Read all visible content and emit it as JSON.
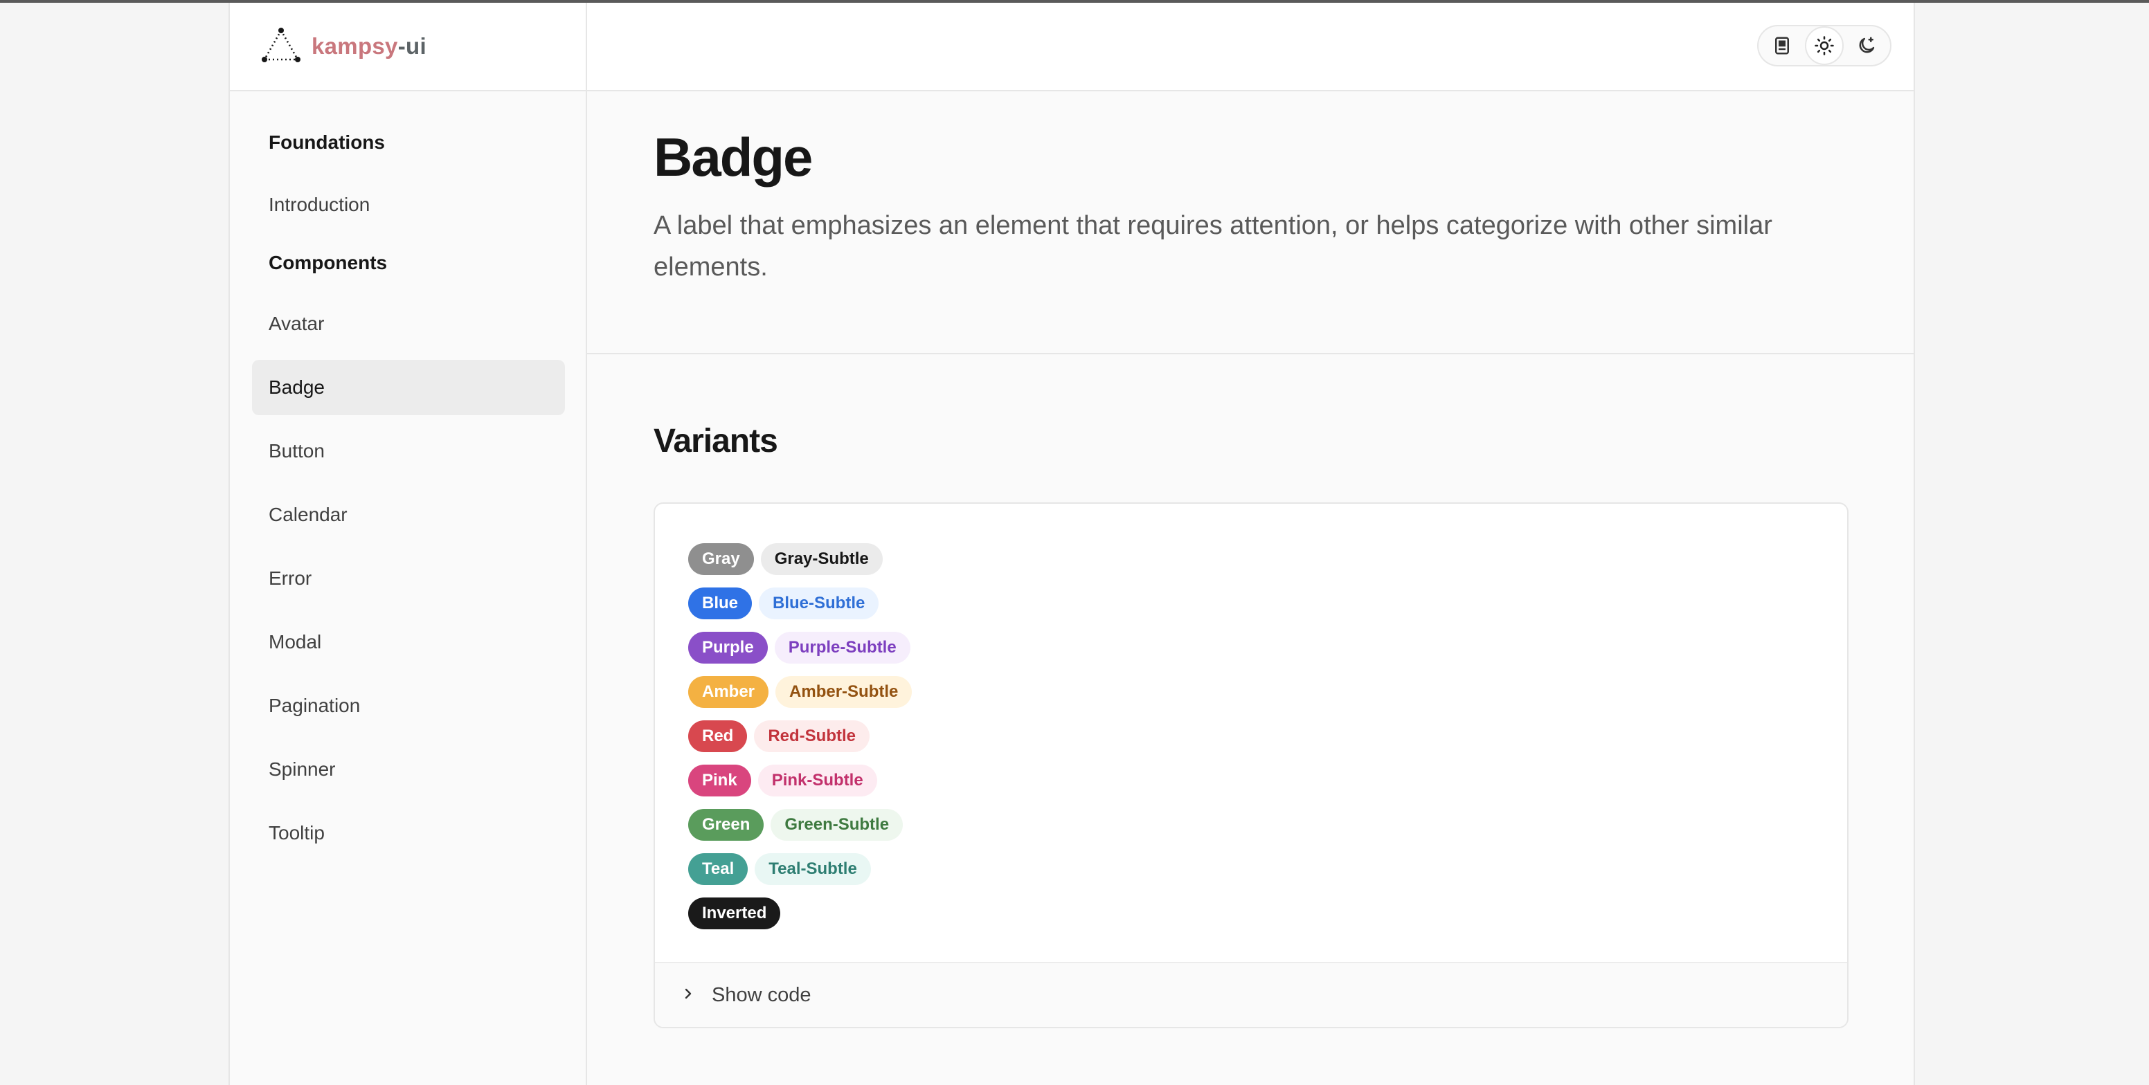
{
  "brand": {
    "name_part1": "kampsy",
    "name_part2": "-ui"
  },
  "sidebar": {
    "foundations_heading": "Foundations",
    "introduction": "Introduction",
    "components_heading": "Components",
    "items": [
      {
        "label": "Avatar"
      },
      {
        "label": "Badge",
        "active": true
      },
      {
        "label": "Button"
      },
      {
        "label": "Calendar"
      },
      {
        "label": "Error"
      },
      {
        "label": "Modal"
      },
      {
        "label": "Pagination"
      },
      {
        "label": "Spinner"
      },
      {
        "label": "Tooltip"
      }
    ]
  },
  "topbar": {
    "theme_buttons": [
      "book-icon",
      "sun-icon",
      "moon-icon"
    ],
    "active_theme": "sun-icon"
  },
  "page": {
    "title": "Badge",
    "description": "A label that emphasizes an element that requires attention, or helps categorize with other similar elements."
  },
  "variants": {
    "title": "Variants",
    "rows": [
      {
        "solid": {
          "label": "Gray",
          "bg": "#8f8f8f",
          "fg": "#ffffff"
        },
        "subtle": {
          "label": "Gray-Subtle",
          "bg": "#ebebeb",
          "fg": "#171717"
        }
      },
      {
        "solid": {
          "label": "Blue",
          "bg": "#2f72e6",
          "fg": "#ffffff"
        },
        "subtle": {
          "label": "Blue-Subtle",
          "bg": "#eaf3ff",
          "fg": "#2f6fd6"
        }
      },
      {
        "solid": {
          "label": "Purple",
          "bg": "#8a4fc8",
          "fg": "#ffffff"
        },
        "subtle": {
          "label": "Purple-Subtle",
          "bg": "#f6eefc",
          "fg": "#7d3fbf"
        }
      },
      {
        "solid": {
          "label": "Amber",
          "bg": "#f4b142",
          "fg": "#ffffff"
        },
        "subtle": {
          "label": "Amber-Subtle",
          "bg": "#fff3dc",
          "fg": "#935211"
        }
      },
      {
        "solid": {
          "label": "Red",
          "bg": "#d8484f",
          "fg": "#ffffff"
        },
        "subtle": {
          "label": "Red-Subtle",
          "bg": "#fdecec",
          "fg": "#c2343c"
        }
      },
      {
        "solid": {
          "label": "Pink",
          "bg": "#d9457e",
          "fg": "#ffffff"
        },
        "subtle": {
          "label": "Pink-Subtle",
          "bg": "#fdebf2",
          "fg": "#c2306b"
        }
      },
      {
        "solid": {
          "label": "Green",
          "bg": "#5a9c5c",
          "fg": "#ffffff"
        },
        "subtle": {
          "label": "Green-Subtle",
          "bg": "#eef7ee",
          "fg": "#3e7a40"
        }
      },
      {
        "solid": {
          "label": "Teal",
          "bg": "#44a094",
          "fg": "#ffffff"
        },
        "subtle": {
          "label": "Teal-Subtle",
          "bg": "#e9f7f4",
          "fg": "#2e7e72"
        }
      },
      {
        "solid": {
          "label": "Inverted",
          "bg": "#1a1a1a",
          "fg": "#ffffff"
        }
      }
    ],
    "show_code_label": "Show code"
  }
}
